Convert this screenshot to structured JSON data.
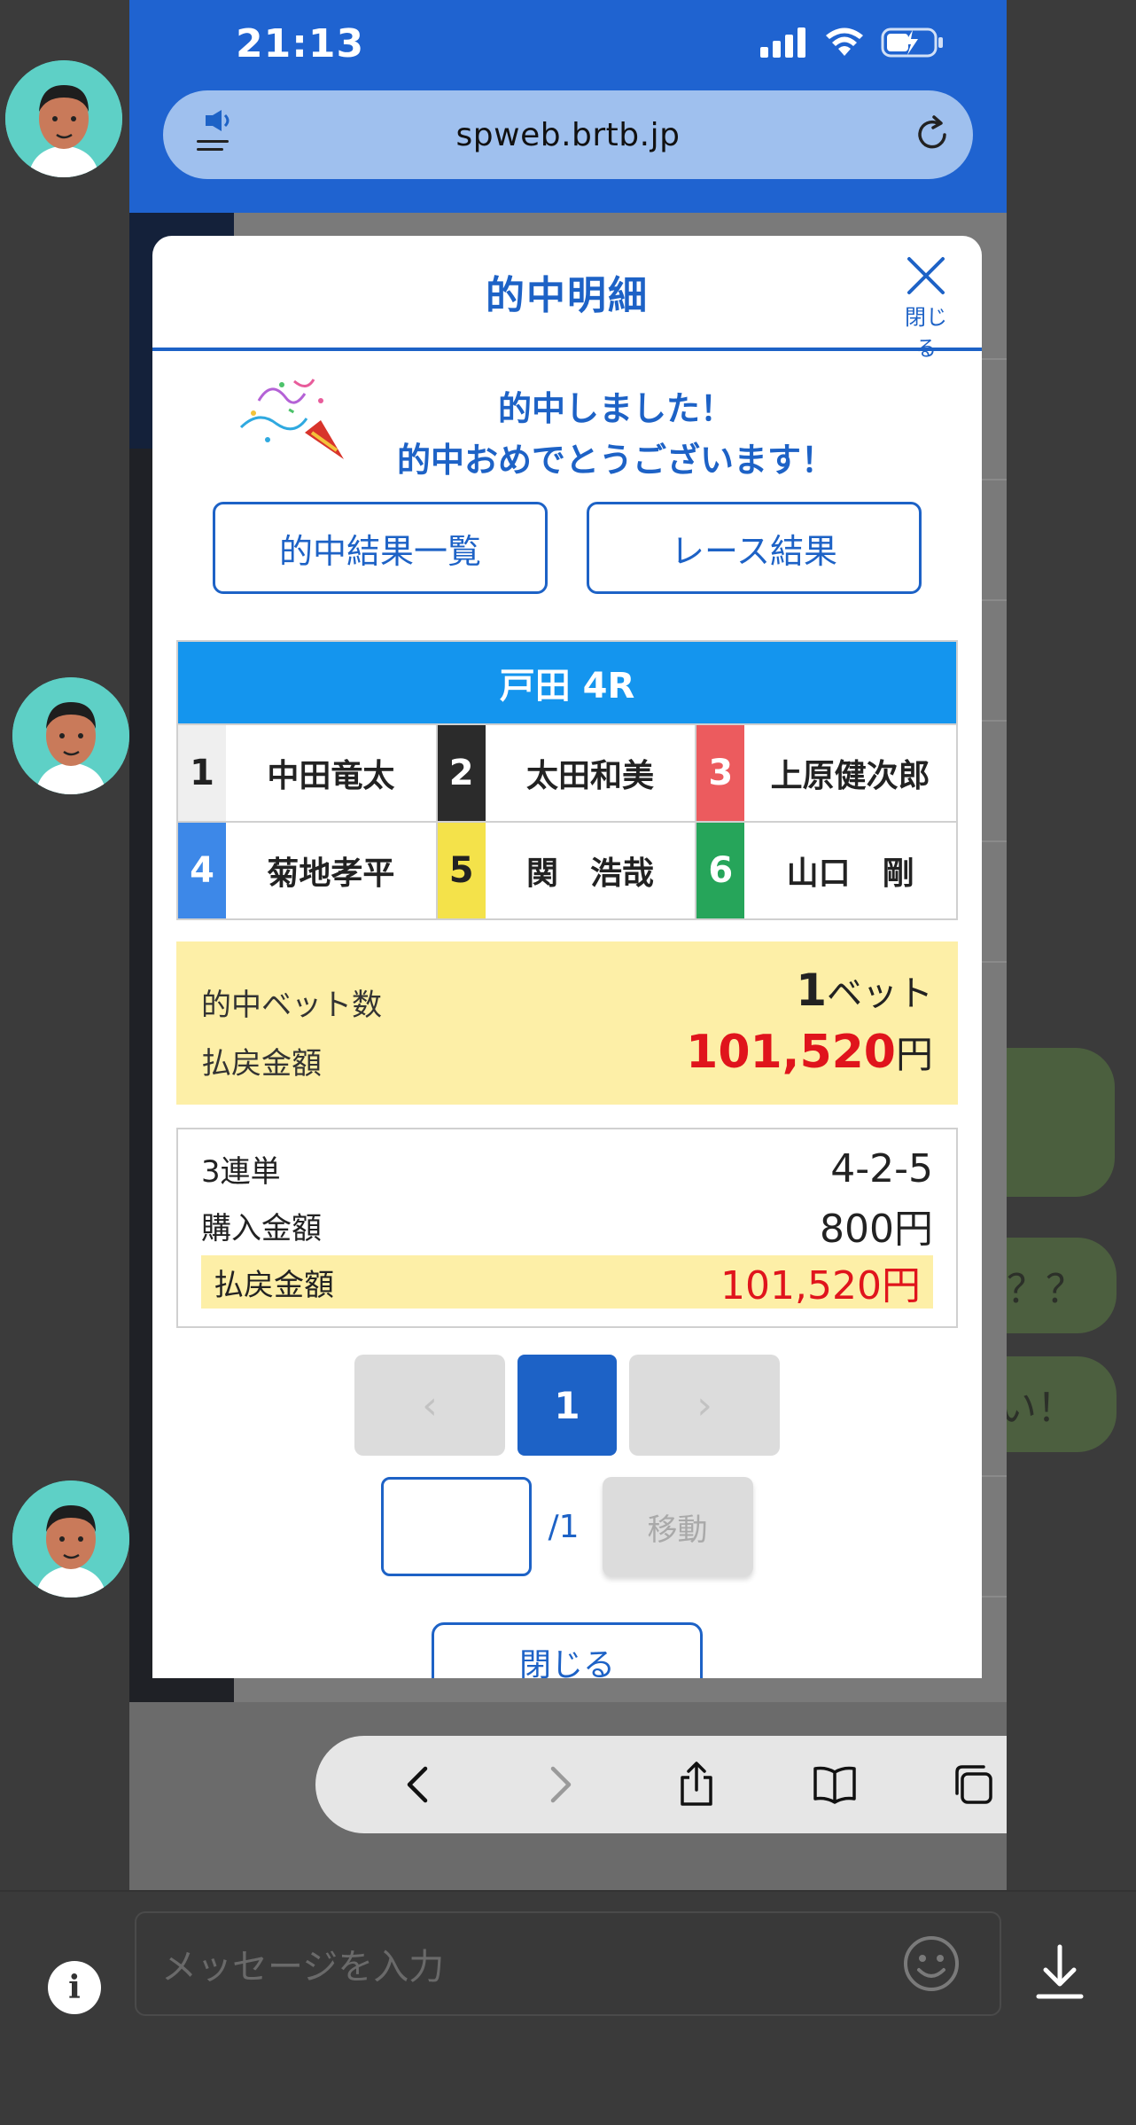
{
  "status_bar": {
    "time": "21:13"
  },
  "browser": {
    "url": "spweb.brtb.jp"
  },
  "modal": {
    "title": "的中明細",
    "close_x_label": "閉じる",
    "congrats_line1": "的中しました！",
    "congrats_line2": "的中おめでとうございます！",
    "btn_results_list": "的中結果一覧",
    "btn_race_results": "レース結果",
    "race_title": "戸田 4R",
    "racers": [
      {
        "lane": "1",
        "name": "中田竜太",
        "lane_bg": "#efefef",
        "lane_fg": "#222222"
      },
      {
        "lane": "2",
        "name": "太田和美",
        "lane_bg": "#2b2b2b",
        "lane_fg": "#ffffff"
      },
      {
        "lane": "3",
        "name": "上原健次郎",
        "lane_bg": "#ec5b5e",
        "lane_fg": "#ffffff"
      },
      {
        "lane": "4",
        "name": "菊地孝平",
        "lane_bg": "#3d88e8",
        "lane_fg": "#ffffff"
      },
      {
        "lane": "5",
        "name": "関　浩哉",
        "lane_bg": "#f4e24a",
        "lane_fg": "#222222"
      },
      {
        "lane": "6",
        "name": "山口　剛",
        "lane_bg": "#26a55a",
        "lane_fg": "#ffffff"
      }
    ],
    "summary": {
      "bets_label": "的中ベット数",
      "bets_value": "1",
      "bets_unit": "ベット",
      "payout_label": "払戻金額",
      "payout_value": "101,520",
      "payout_unit": "円"
    },
    "detail": {
      "bet_type": "3連単",
      "combination": "4-2-5",
      "purchase_label": "購入金額",
      "purchase_value": "800円",
      "payout_label": "払戻金額",
      "payout_value": "101,520円"
    },
    "pager": {
      "prev": "‹",
      "current": "1",
      "next": "›"
    },
    "jump": {
      "input_value": "",
      "total": "/1",
      "button": "移動"
    },
    "close_button": "閉じる"
  },
  "chat": {
    "bubble_2": "？？",
    "bubble_3": "い！",
    "input_placeholder": "メッセージを入力",
    "info_label": "i"
  },
  "colors": {
    "accent": "#1d62c6",
    "race_header": "#1495ee",
    "highlight": "#fdefa7",
    "payout_red": "#e0141c"
  }
}
